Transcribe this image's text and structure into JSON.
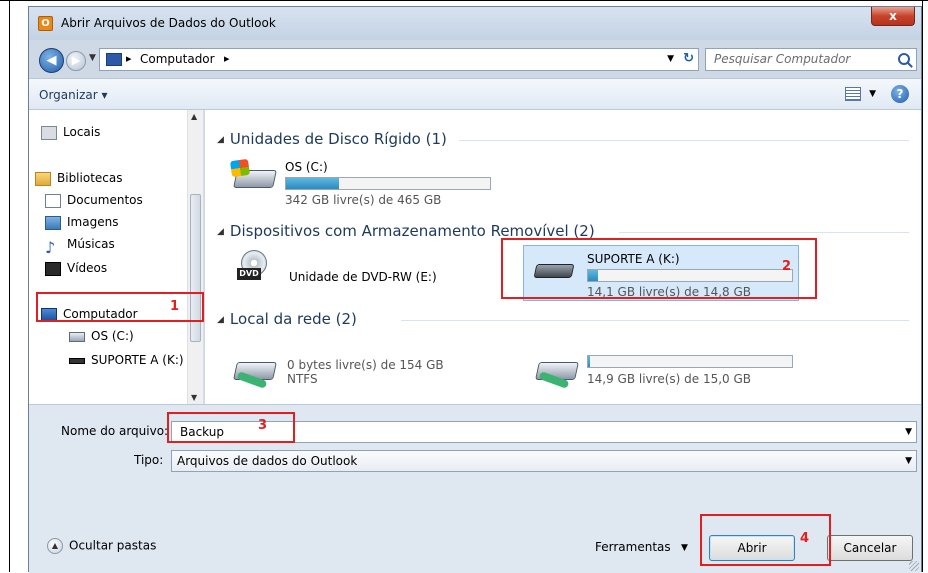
{
  "window": {
    "title": "Abrir Arquivos de Dados do Outlook",
    "close_label": "x",
    "app_icon": "outlook-icon"
  },
  "address": {
    "path": "Computador",
    "search_placeholder": "Pesquisar Computador"
  },
  "toolbar": {
    "organize_label": "Organizar ▾"
  },
  "sidebar": {
    "items": [
      {
        "label": "Locais",
        "icon": "places-icon"
      },
      {
        "label": "Bibliotecas",
        "icon": "folder-icon"
      },
      {
        "label": "Documentos",
        "icon": "document-icon"
      },
      {
        "label": "Imagens",
        "icon": "image-icon"
      },
      {
        "label": "Músicas",
        "icon": "music-icon"
      },
      {
        "label": "Vídeos",
        "icon": "video-icon"
      },
      {
        "label": "Computador",
        "icon": "computer-icon",
        "selected": true
      },
      {
        "label": "OS (C:)",
        "icon": "hard-drive-icon"
      },
      {
        "label": "SUPORTE A (K:)",
        "icon": "usb-drive-icon"
      }
    ]
  },
  "groups": {
    "hdd_header": "Unidades de Disco Rígido (1)",
    "removable_header": "Dispositivos com Armazenamento Removível (2)",
    "network_header": "Local da rede (2)"
  },
  "drives": {
    "c": {
      "name": "OS (C:)",
      "info": "342 GB livre(s) de 465 GB",
      "used_fraction": 0.26
    },
    "dvd": {
      "name": "Unidade de DVD-RW (E:)",
      "label": "DVD"
    },
    "k": {
      "name": "SUPORTE A (K:)",
      "info": "14,1 GB livre(s) de 14,8 GB",
      "used_fraction": 0.05
    },
    "net1": {
      "info": "0 bytes livre(s) de 154 GB",
      "fs": "NTFS"
    },
    "net2": {
      "info": "14,9 GB livre(s) de 15,0 GB",
      "used_fraction": 0.01
    }
  },
  "form": {
    "filename_label": "Nome do arquivo:",
    "filename_value": "Backup",
    "type_label": "Tipo:",
    "type_value": "Arquivos de dados do Outlook"
  },
  "footer": {
    "hide_folders": "Ocultar pastas",
    "tools": "Ferramentas",
    "open": "Abrir",
    "cancel": "Cancelar"
  },
  "callouts": [
    "1",
    "2",
    "3",
    "4"
  ],
  "colors": {
    "callout": "#e02020",
    "selection": "#d6e9fb",
    "header_text": "#1e395b"
  }
}
